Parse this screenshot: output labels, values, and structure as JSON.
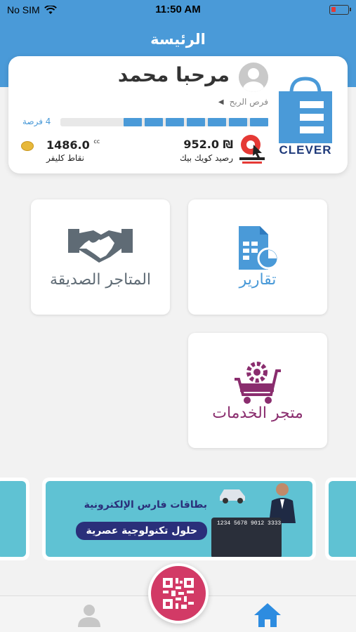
{
  "status_bar": {
    "carrier": "No SIM",
    "time": "11:50 AM"
  },
  "header": {
    "title": "الرئيسة"
  },
  "profile": {
    "greeting": "مرحبا محمد",
    "profit_chances_label": "فرص الربح",
    "chances_count": "4 فرصة",
    "progress_fraction": 0.68,
    "brand_logo_text": "CLEVER",
    "quickpick_balance": "952.0 ₪",
    "quickpick_label": "رصيد كويك بيك",
    "points_value": "1486.0",
    "points_unit": "cc",
    "points_label": "نقاط كليفر"
  },
  "tiles": {
    "reports": {
      "label": "تقارير",
      "icon": "reports-icon",
      "color": "#4a9ad8"
    },
    "partner_stores": {
      "label": "المتاجر الصديقة",
      "icon": "handshake-icon",
      "color": "#5f6b75"
    },
    "services_store": {
      "label": "متجر الخدمات",
      "icon": "cart-gear-icon",
      "color": "#8a2d6e"
    }
  },
  "banner": {
    "title": "بطاقات فارس الإلكترونية",
    "subtitle": "حلول تكنولوجية عصرية",
    "card_number": "1234 5678 9012 3333"
  },
  "bottom_nav": {
    "profile_icon": "person-icon",
    "home_icon": "home-icon",
    "center_button_icon": "qr-code-icon"
  },
  "colors": {
    "primary": "#4a9ad8",
    "fab": "#d23a66",
    "banner_bg": "#5fc2d3",
    "banner_text": "#2a2f7a"
  }
}
